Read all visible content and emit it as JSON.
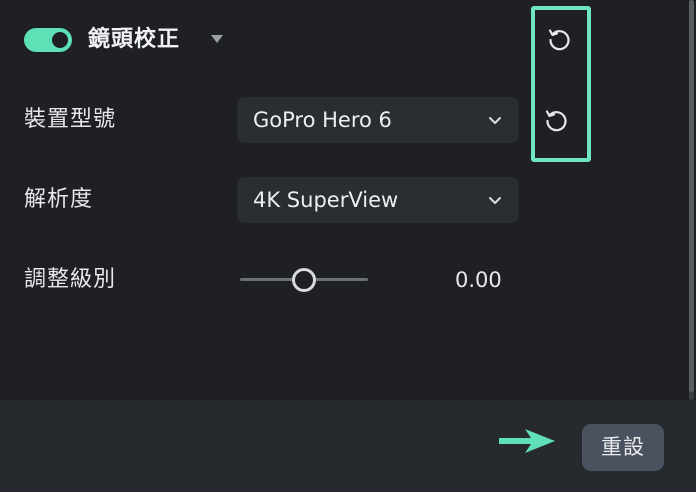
{
  "section": {
    "title": "鏡頭校正",
    "toggle_on": true
  },
  "rows": {
    "device_model": {
      "label": "裝置型號",
      "value": "GoPro Hero 6"
    },
    "resolution": {
      "label": "解析度",
      "value": "4K SuperView"
    },
    "adjust_level": {
      "label": "調整級別",
      "value": "0.00"
    }
  },
  "footer": {
    "reset_label": "重設"
  },
  "colors": {
    "accent": "#5fe0b6",
    "highlight": "#6ee7c1",
    "panel_bg": "#1e2024",
    "footer_bg": "#26292e",
    "button_bg": "#4a5260"
  },
  "icons": {
    "section_reset": "reset-icon",
    "device_reset": "reset-icon",
    "dropdown": "chevron-down-icon",
    "pointer": "arrow-right-icon"
  }
}
